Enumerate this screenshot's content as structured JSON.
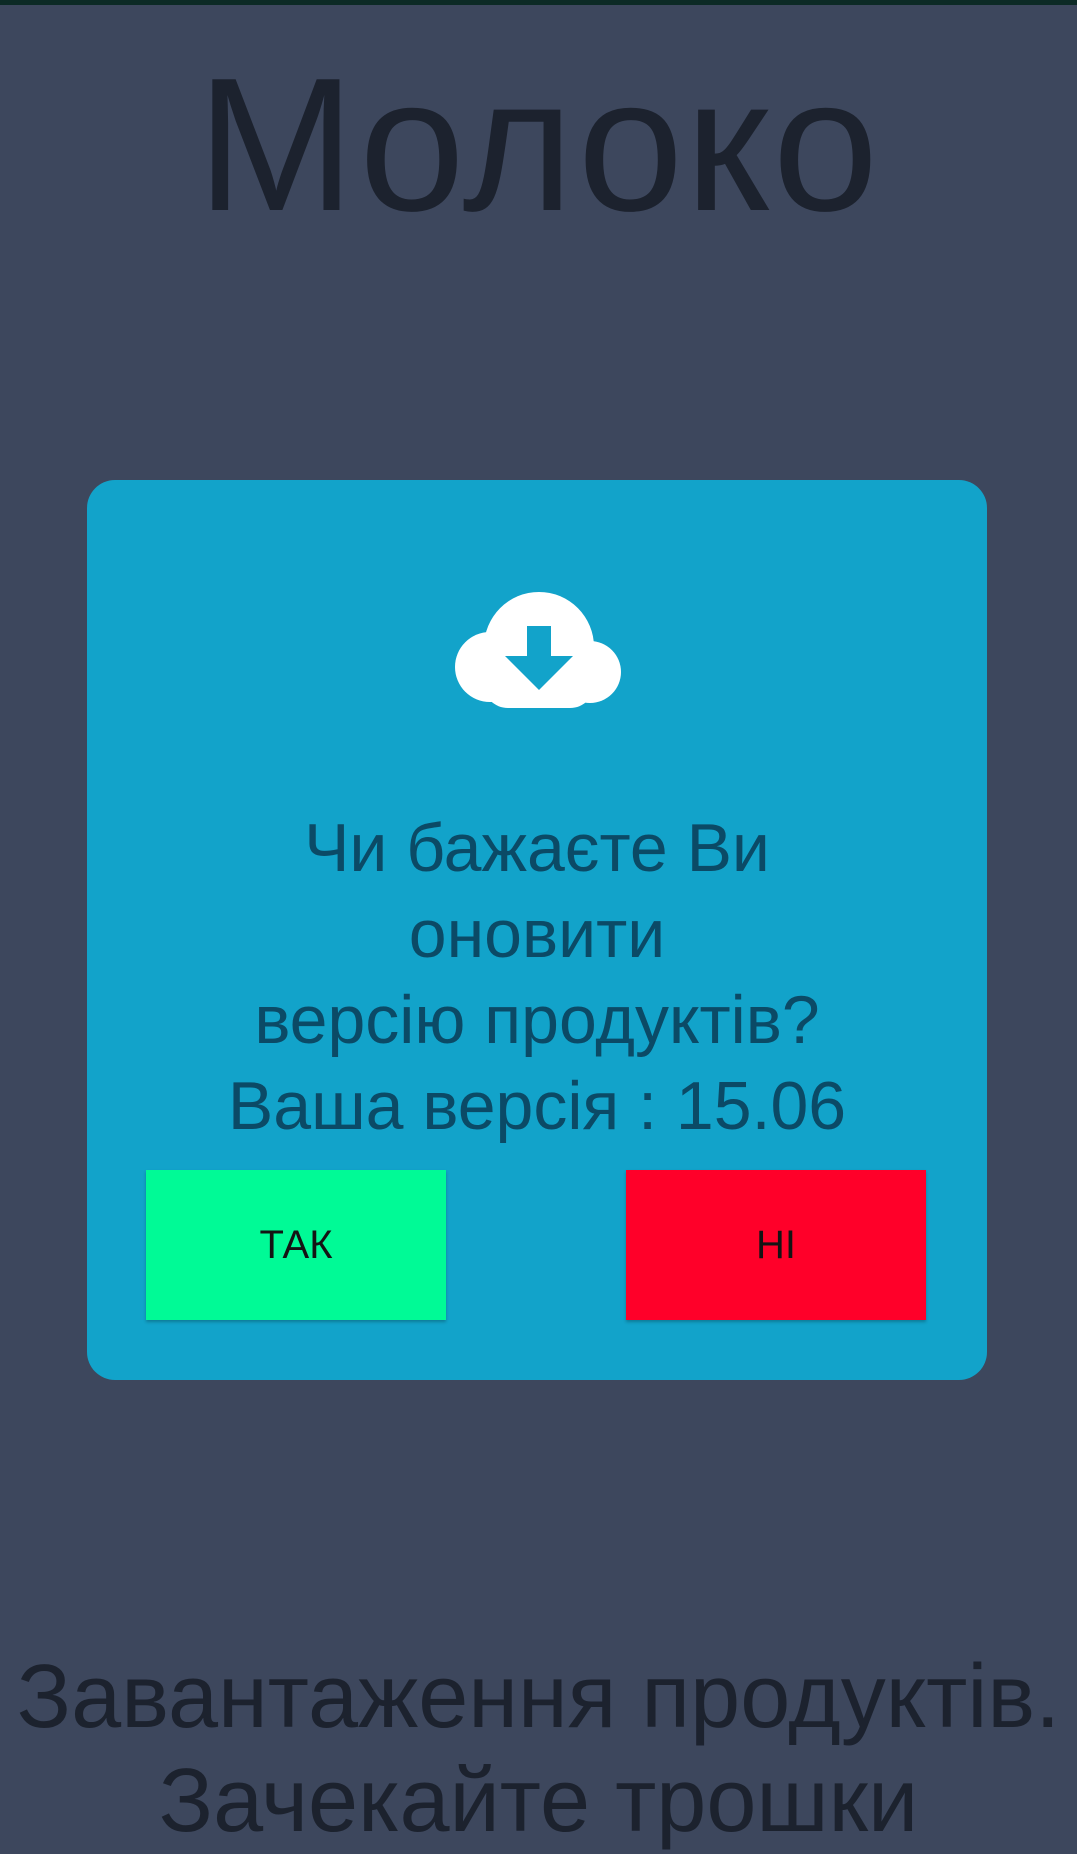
{
  "app": {
    "title": "Молоко"
  },
  "dialog": {
    "icon": "cloud-download-icon",
    "message_lines": [
      "Чи бажаєте Ви",
      "оновити",
      "версію продуктів?",
      "Ваша версія : 15.06"
    ],
    "yes_label": "ТАК",
    "no_label": "НІ"
  },
  "loading": {
    "lines": [
      "Завантаження продуктів.",
      "Зачекайте трошки"
    ]
  },
  "colors": {
    "background": "#3d475d",
    "dialog": "#12a3ca",
    "yes_button": "#00fa96",
    "no_button": "#ff0029",
    "text_dark": "#1c222e",
    "message_text": "#0b4a66"
  }
}
